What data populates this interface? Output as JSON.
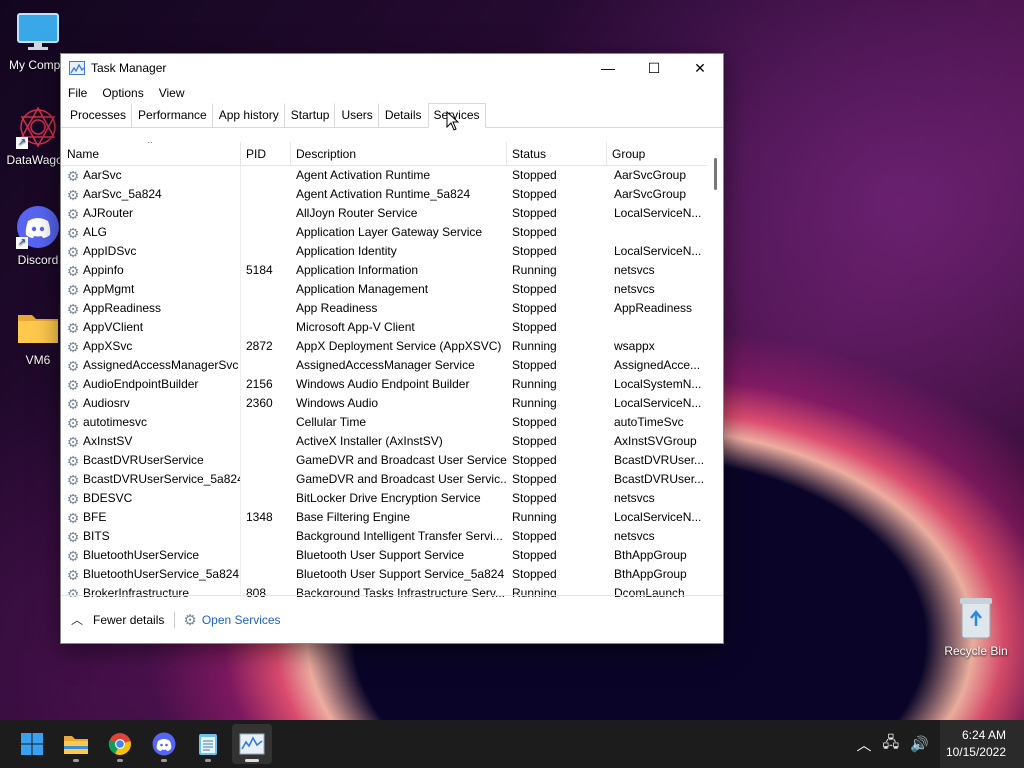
{
  "desktop": {
    "icons": [
      {
        "label": "My Compu"
      },
      {
        "label": "DataWagon"
      },
      {
        "label": "Discord"
      },
      {
        "label": "VM6"
      }
    ],
    "recycle_bin": "Recycle Bin"
  },
  "window": {
    "title": "Task Manager",
    "controls": {
      "minimize": "—",
      "maximize": "☐",
      "close": "✕"
    }
  },
  "menu": [
    "File",
    "Options",
    "View"
  ],
  "tabs": [
    "Processes",
    "Performance",
    "App history",
    "Startup",
    "Users",
    "Details",
    "Services"
  ],
  "active_tab": "Services",
  "columns": {
    "name": "Name",
    "pid": "PID",
    "description": "Description",
    "status": "Status",
    "group": "Group"
  },
  "services": [
    {
      "name": "AarSvc",
      "pid": "",
      "description": "Agent Activation Runtime",
      "status": "Stopped",
      "group": "AarSvcGroup"
    },
    {
      "name": "AarSvc_5a824",
      "pid": "",
      "description": "Agent Activation Runtime_5a824",
      "status": "Stopped",
      "group": "AarSvcGroup"
    },
    {
      "name": "AJRouter",
      "pid": "",
      "description": "AllJoyn Router Service",
      "status": "Stopped",
      "group": "LocalServiceN..."
    },
    {
      "name": "ALG",
      "pid": "",
      "description": "Application Layer Gateway Service",
      "status": "Stopped",
      "group": ""
    },
    {
      "name": "AppIDSvc",
      "pid": "",
      "description": "Application Identity",
      "status": "Stopped",
      "group": "LocalServiceN..."
    },
    {
      "name": "Appinfo",
      "pid": "5184",
      "description": "Application Information",
      "status": "Running",
      "group": "netsvcs"
    },
    {
      "name": "AppMgmt",
      "pid": "",
      "description": "Application Management",
      "status": "Stopped",
      "group": "netsvcs"
    },
    {
      "name": "AppReadiness",
      "pid": "",
      "description": "App Readiness",
      "status": "Stopped",
      "group": "AppReadiness"
    },
    {
      "name": "AppVClient",
      "pid": "",
      "description": "Microsoft App-V Client",
      "status": "Stopped",
      "group": ""
    },
    {
      "name": "AppXSvc",
      "pid": "2872",
      "description": "AppX Deployment Service (AppXSVC)",
      "status": "Running",
      "group": "wsappx"
    },
    {
      "name": "AssignedAccessManagerSvc",
      "pid": "",
      "description": "AssignedAccessManager Service",
      "status": "Stopped",
      "group": "AssignedAcce..."
    },
    {
      "name": "AudioEndpointBuilder",
      "pid": "2156",
      "description": "Windows Audio Endpoint Builder",
      "status": "Running",
      "group": "LocalSystemN..."
    },
    {
      "name": "Audiosrv",
      "pid": "2360",
      "description": "Windows Audio",
      "status": "Running",
      "group": "LocalServiceN..."
    },
    {
      "name": "autotimesvc",
      "pid": "",
      "description": "Cellular Time",
      "status": "Stopped",
      "group": "autoTimeSvc"
    },
    {
      "name": "AxInstSV",
      "pid": "",
      "description": "ActiveX Installer (AxInstSV)",
      "status": "Stopped",
      "group": "AxInstSVGroup"
    },
    {
      "name": "BcastDVRUserService",
      "pid": "",
      "description": "GameDVR and Broadcast User Service",
      "status": "Stopped",
      "group": "BcastDVRUser..."
    },
    {
      "name": "BcastDVRUserService_5a824",
      "pid": "",
      "description": "GameDVR and Broadcast User Servic...",
      "status": "Stopped",
      "group": "BcastDVRUser..."
    },
    {
      "name": "BDESVC",
      "pid": "",
      "description": "BitLocker Drive Encryption Service",
      "status": "Stopped",
      "group": "netsvcs"
    },
    {
      "name": "BFE",
      "pid": "1348",
      "description": "Base Filtering Engine",
      "status": "Running",
      "group": "LocalServiceN..."
    },
    {
      "name": "BITS",
      "pid": "",
      "description": "Background Intelligent Transfer Servi...",
      "status": "Stopped",
      "group": "netsvcs"
    },
    {
      "name": "BluetoothUserService",
      "pid": "",
      "description": "Bluetooth User Support Service",
      "status": "Stopped",
      "group": "BthAppGroup"
    },
    {
      "name": "BluetoothUserService_5a824",
      "pid": "",
      "description": "Bluetooth User Support Service_5a824",
      "status": "Stopped",
      "group": "BthAppGroup"
    },
    {
      "name": "BrokerInfrastructure",
      "pid": "808",
      "description": "Background Tasks Infrastructure Serv...",
      "status": "Running",
      "group": "DcomLaunch"
    }
  ],
  "footer": {
    "fewer_details": "Fewer details",
    "open_services": "Open Services"
  },
  "taskbar": {
    "apps": [
      {
        "icon": "windows-start-icon"
      },
      {
        "icon": "file-explorer-icon"
      },
      {
        "icon": "chrome-icon"
      },
      {
        "icon": "discord-icon"
      },
      {
        "icon": "notepad-icon"
      },
      {
        "icon": "task-manager-icon"
      }
    ],
    "clock": {
      "time": "6:24 AM",
      "date": "10/15/2022"
    }
  },
  "colors": {
    "accent": "#1a63c7",
    "taskbar": "#1c1c1c"
  }
}
